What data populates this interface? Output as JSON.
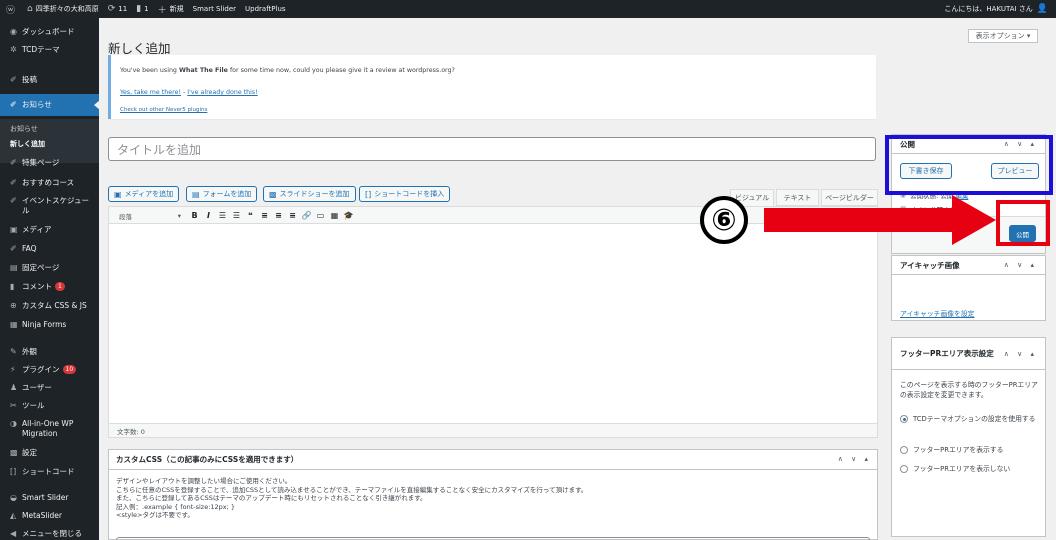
{
  "admin_bar": {
    "site_name": "四季折々の大和高原",
    "updates_count": "11",
    "comments_count": "1",
    "new_label": "新規",
    "plugin1": "Smart Slider",
    "plugin2": "UpdraftPlus",
    "greeting": "こんにちは、HAKUTAI さん"
  },
  "sidebar": {
    "dashboard": "ダッシュボード",
    "tcd_theme": "TCDテーマ",
    "posts": "投稿",
    "news": "お知らせ",
    "sub_news": "お知らせ",
    "sub_add_new": "新しく追加",
    "feature_pages": "特集ページ",
    "recommended": "おすすめコース",
    "event_schedule": "イベントスケジュール",
    "media": "メディア",
    "faq": "FAQ",
    "fixed_page": "固定ページ",
    "comments": "コメント",
    "comments_badge": "1",
    "custom_css_js": "カスタム CSS & JS",
    "ninja_forms": "Ninja Forms",
    "appearance": "外観",
    "plugins": "プラグイン",
    "plugins_badge": "10",
    "users": "ユーザー",
    "tools": "ツール",
    "all_in_one": "All-in-One WP Migration",
    "settings": "設定",
    "shortcode": "ショートコード",
    "smart_slider": "Smart Slider",
    "metaslider": "MetaSlider",
    "collapse": "メニューを閉じる"
  },
  "header": {
    "screen_options": "表示オプション ▾",
    "page_title": "新しく追加"
  },
  "notice": {
    "message_prefix": "You've been using ",
    "message_bold": "What The File",
    "message_suffix": " for some time now, could you please give it a review at wordpress.org?",
    "link_yes": "Yes, take me there!",
    "separator": " - ",
    "link_done": "I've already done this!",
    "link_other": "Check out other Never5 plugins"
  },
  "editor": {
    "title_placeholder": "タイトルを追加",
    "btn_add_media": "メディアを追加",
    "btn_add_form": "フォームを追加",
    "btn_add_slideshow": "スライドショーを追加",
    "btn_insert_shortcode": "ショートコードを挿入",
    "tab_visual": "ビジュアル",
    "tab_text": "テキスト",
    "tab_page_builder": "ページビルダー",
    "format_select": "段落",
    "word_count": "文字数: 0"
  },
  "custom_css": {
    "heading": "カスタムCSS（この記事のみにCSSを適用できます）",
    "line1": "デザインやレイアウトを調整したい場合にご使用ください。",
    "line2": "こちらに任意のCSSを登録することで、追加CSSとして読み込ませることができ、テーマファイルを直接編集することなく安全にカスタマイズを行って頂けます。",
    "line3": "また、こちらに登録してあるCSSはテーマのアップデート時にもリセットされることなく引き継がれます。",
    "line4": "記入例：.example { font-size:12px; }",
    "line5": "<style>タグは不要です。"
  },
  "publish": {
    "heading": "公開",
    "save_draft": "下書き保存",
    "preview": "プレビュー",
    "status_label": "公開状態:",
    "status_value": "公開",
    "status_edit": "編集",
    "schedule_label": "すぐに公開する",
    "schedule_edit": "編集",
    "publish_button": "公開"
  },
  "featured_image": {
    "heading": "アイキャッチ画像",
    "set_link": "アイキャッチ画像を設定"
  },
  "footer_pr": {
    "heading": "フッターPRエリア表示設定",
    "description": "このページを表示する時のフッターPRエリアの表示設定を変更できます。",
    "option1": "TCDテーマオプションの設定を使用する",
    "option2": "フッターPRエリアを表示する",
    "option3": "フッターPRエリアを表示しない"
  },
  "annotation": {
    "step_number": "⑥",
    "arrow_color": "#e60012",
    "highlight_blue": "#1c10d8",
    "highlight_red": "#e60012"
  }
}
